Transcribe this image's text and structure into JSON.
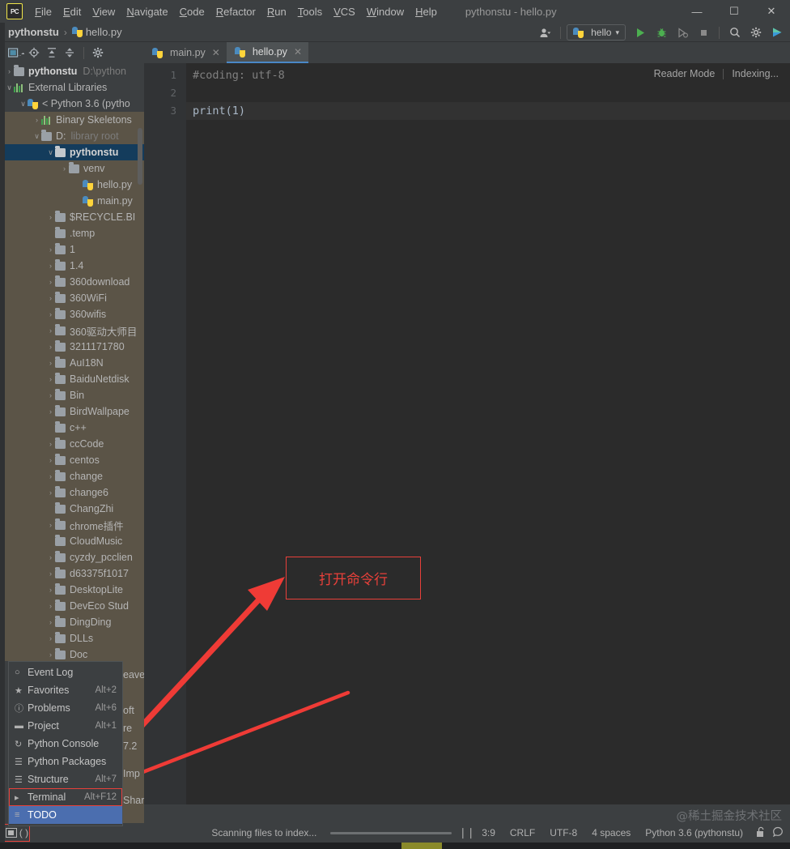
{
  "titlebar": {
    "logo": "PC",
    "menus": [
      "File",
      "Edit",
      "View",
      "Navigate",
      "Code",
      "Refactor",
      "Run",
      "Tools",
      "VCS",
      "Window",
      "Help"
    ],
    "window_title": "pythonstu - hello.py",
    "minimize": "—",
    "maximize": "☐",
    "close": "✕"
  },
  "navbar": {
    "project": "pythonstu",
    "separator": "›",
    "file": "hello.py",
    "profile_icon": "user-icon",
    "run_config": "hello",
    "dropdown_caret": "▾",
    "run_icon": "▶",
    "debug_icon": "debug-icon",
    "coverage_icon": "coverage-icon",
    "stop_icon": "■",
    "search_icon": "⌕",
    "settings_icon": "⚙",
    "updates_icon": "updates-icon"
  },
  "project_toolbar": {
    "select_opened_file": "select-opened-file-icon",
    "locate": "⊕",
    "expand_all": "expand-all-icon",
    "collapse_all": "collapse-all-icon",
    "settings": "⚙"
  },
  "tree": [
    {
      "indent": 0,
      "arrow": "›",
      "icon": "folder",
      "label": "pythonstu",
      "bold": true,
      "path": "D:\\python",
      "state": "normal"
    },
    {
      "indent": 0,
      "arrow": "∨",
      "icon": "lib",
      "label": "External Libraries",
      "bold": false,
      "path": "",
      "state": "normal"
    },
    {
      "indent": 1,
      "arrow": "∨",
      "icon": "python",
      "label": "< Python 3.6 (pytho",
      "bold": false,
      "path": "",
      "state": "normal"
    },
    {
      "indent": 2,
      "arrow": "›",
      "icon": "lib",
      "label": "Binary Skeletons",
      "bold": false,
      "path": "",
      "state": "dim"
    },
    {
      "indent": 2,
      "arrow": "∨",
      "icon": "folder",
      "label": "D:",
      "bold": false,
      "path": "library root",
      "state": "dim"
    },
    {
      "indent": 3,
      "arrow": "∨",
      "icon": "folder",
      "label": "pythonstu",
      "bold": true,
      "path": "",
      "state": "sel"
    },
    {
      "indent": 4,
      "arrow": "›",
      "icon": "folder",
      "label": "venv",
      "bold": false,
      "path": "",
      "state": "dim"
    },
    {
      "indent": 5,
      "arrow": "",
      "icon": "python",
      "label": "hello.py",
      "bold": false,
      "path": "",
      "state": "dim"
    },
    {
      "indent": 5,
      "arrow": "",
      "icon": "python",
      "label": "main.py",
      "bold": false,
      "path": "",
      "state": "dim"
    },
    {
      "indent": 3,
      "arrow": "›",
      "icon": "folder",
      "label": "$RECYCLE.BI",
      "bold": false,
      "path": "",
      "state": "dim"
    },
    {
      "indent": 3,
      "arrow": "",
      "icon": "folder",
      "label": ".temp",
      "bold": false,
      "path": "",
      "state": "dim"
    },
    {
      "indent": 3,
      "arrow": "›",
      "icon": "folder",
      "label": "1",
      "bold": false,
      "path": "",
      "state": "dim"
    },
    {
      "indent": 3,
      "arrow": "›",
      "icon": "folder",
      "label": "1.4",
      "bold": false,
      "path": "",
      "state": "dim"
    },
    {
      "indent": 3,
      "arrow": "›",
      "icon": "folder",
      "label": "360download",
      "bold": false,
      "path": "",
      "state": "dim"
    },
    {
      "indent": 3,
      "arrow": "›",
      "icon": "folder",
      "label": "360WiFi",
      "bold": false,
      "path": "",
      "state": "dim"
    },
    {
      "indent": 3,
      "arrow": "›",
      "icon": "folder",
      "label": "360wifis",
      "bold": false,
      "path": "",
      "state": "dim"
    },
    {
      "indent": 3,
      "arrow": "›",
      "icon": "folder",
      "label": "360驱动大师目",
      "bold": false,
      "path": "",
      "state": "dim"
    },
    {
      "indent": 3,
      "arrow": "›",
      "icon": "folder",
      "label": "3211171780",
      "bold": false,
      "path": "",
      "state": "dim"
    },
    {
      "indent": 3,
      "arrow": "›",
      "icon": "folder",
      "label": "AuI18N",
      "bold": false,
      "path": "",
      "state": "dim"
    },
    {
      "indent": 3,
      "arrow": "›",
      "icon": "folder",
      "label": "BaiduNetdisk",
      "bold": false,
      "path": "",
      "state": "dim"
    },
    {
      "indent": 3,
      "arrow": "›",
      "icon": "folder",
      "label": "Bin",
      "bold": false,
      "path": "",
      "state": "dim"
    },
    {
      "indent": 3,
      "arrow": "›",
      "icon": "folder",
      "label": "BirdWallpape",
      "bold": false,
      "path": "",
      "state": "dim"
    },
    {
      "indent": 3,
      "arrow": "",
      "icon": "folder",
      "label": "c++",
      "bold": false,
      "path": "",
      "state": "dim"
    },
    {
      "indent": 3,
      "arrow": "›",
      "icon": "folder",
      "label": "ccCode",
      "bold": false,
      "path": "",
      "state": "dim"
    },
    {
      "indent": 3,
      "arrow": "›",
      "icon": "folder",
      "label": "centos",
      "bold": false,
      "path": "",
      "state": "dim"
    },
    {
      "indent": 3,
      "arrow": "›",
      "icon": "folder",
      "label": "change",
      "bold": false,
      "path": "",
      "state": "dim"
    },
    {
      "indent": 3,
      "arrow": "›",
      "icon": "folder",
      "label": "change6",
      "bold": false,
      "path": "",
      "state": "dim"
    },
    {
      "indent": 3,
      "arrow": "",
      "icon": "folder",
      "label": "ChangZhi",
      "bold": false,
      "path": "",
      "state": "dim"
    },
    {
      "indent": 3,
      "arrow": "›",
      "icon": "folder",
      "label": "chrome插件",
      "bold": false,
      "path": "",
      "state": "dim"
    },
    {
      "indent": 3,
      "arrow": "",
      "icon": "folder",
      "label": "CloudMusic",
      "bold": false,
      "path": "",
      "state": "dim"
    },
    {
      "indent": 3,
      "arrow": "›",
      "icon": "folder",
      "label": "cyzdy_pcclien",
      "bold": false,
      "path": "",
      "state": "dim"
    },
    {
      "indent": 3,
      "arrow": "›",
      "icon": "folder",
      "label": "d63375f1017",
      "bold": false,
      "path": "",
      "state": "dim"
    },
    {
      "indent": 3,
      "arrow": "›",
      "icon": "folder",
      "label": "DesktopLite",
      "bold": false,
      "path": "",
      "state": "dim"
    },
    {
      "indent": 3,
      "arrow": "›",
      "icon": "folder",
      "label": "DevEco Stud",
      "bold": false,
      "path": "",
      "state": "dim"
    },
    {
      "indent": 3,
      "arrow": "›",
      "icon": "folder",
      "label": "DingDing",
      "bold": false,
      "path": "",
      "state": "dim"
    },
    {
      "indent": 3,
      "arrow": "›",
      "icon": "folder",
      "label": "DLLs",
      "bold": false,
      "path": "",
      "state": "dim"
    },
    {
      "indent": 3,
      "arrow": "›",
      "icon": "folder",
      "label": "Doc",
      "bold": false,
      "path": "",
      "state": "dim"
    }
  ],
  "tree_obscured": [
    "eave",
    "oft",
    "re",
    "7.2",
    "Imp",
    "Shar"
  ],
  "tabs": [
    {
      "label": "main.py",
      "active": false,
      "close": "✕"
    },
    {
      "label": "hello.py",
      "active": true,
      "close": "✕"
    }
  ],
  "editor": {
    "line_numbers": [
      "1",
      "2",
      "3"
    ],
    "lines": [
      {
        "text": "#coding: utf-8",
        "type": "comment",
        "current": false
      },
      {
        "text": "",
        "type": "code",
        "current": false
      },
      {
        "text": "print(1)",
        "type": "code",
        "current": true
      }
    ],
    "reader_mode": "Reader Mode",
    "indexing": "Indexing..."
  },
  "annotation": {
    "text": "打开命令行",
    "color": "#e8403a"
  },
  "popup": {
    "items": [
      {
        "icon": "event-log-icon",
        "label": "Event Log",
        "shortcut": "",
        "selected": false,
        "boxed": false
      },
      {
        "icon": "star-icon",
        "label": "Favorites",
        "shortcut": "Alt+2",
        "selected": false,
        "boxed": false
      },
      {
        "icon": "problems-icon",
        "label": "Problems",
        "shortcut": "Alt+6",
        "selected": false,
        "boxed": false
      },
      {
        "icon": "folder-icon",
        "label": "Project",
        "shortcut": "Alt+1",
        "selected": false,
        "boxed": false
      },
      {
        "icon": "python-console-icon",
        "label": "Python Console",
        "shortcut": "",
        "selected": false,
        "boxed": false
      },
      {
        "icon": "packages-icon",
        "label": "Python Packages",
        "shortcut": "",
        "selected": false,
        "boxed": false
      },
      {
        "icon": "structure-icon",
        "label": "Structure",
        "shortcut": "Alt+7",
        "selected": false,
        "boxed": false
      },
      {
        "icon": "terminal-icon",
        "label": "Terminal",
        "shortcut": "Alt+F12",
        "selected": false,
        "boxed": true
      },
      {
        "icon": "todo-icon",
        "label": "TODO",
        "shortcut": "",
        "selected": true,
        "boxed": false
      }
    ]
  },
  "statusbar": {
    "layout_icon": "layout-toggle-icon",
    "status_text": "Scanning files to index...",
    "pause_icon": "❘❘",
    "caret": "3:9",
    "line_sep": "CRLF",
    "encoding": "UTF-8",
    "indent": "4 spaces",
    "interpreter": "Python 3.6 (pythonstu)",
    "lock_icon": "unlock-icon",
    "event_icon": "event-log-icon"
  },
  "watermark": "@稀土掘金技术社区"
}
